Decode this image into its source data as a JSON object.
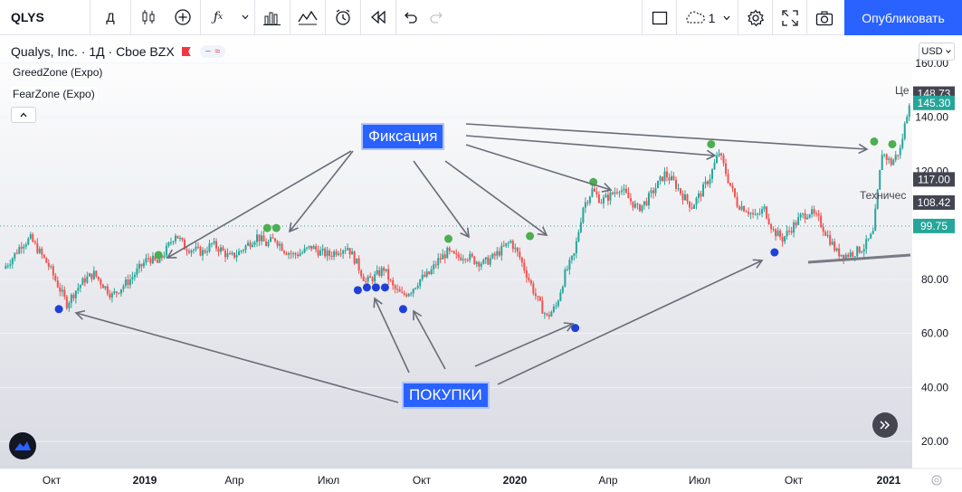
{
  "toolbar": {
    "symbol": "QLYS",
    "interval": "Д",
    "publish_label": "Опубликовать",
    "layout_count": "1",
    "icons": [
      "candles-icon",
      "add-indicator-icon",
      "fx-icon",
      "chevron-down-icon",
      "bar-chart-icon",
      "line-chart-icon",
      "alarm-icon",
      "rewind-icon",
      "undo-icon",
      "redo-icon",
      "rectangle-icon",
      "cloud-icon",
      "gear-icon",
      "fullscreen-icon",
      "camera-icon"
    ]
  },
  "legend": {
    "title": "Qualys, Inc. · 1Д · Cboe BZX",
    "pill_a": "−",
    "pill_b": "≈",
    "indicator1": "GreedZone (Expo)",
    "indicator2": "FearZone (Expo)",
    "collapse_label": "^"
  },
  "currency_label": "USD",
  "side_labels": {
    "price_partial": "Це",
    "technical_partial": "Техничес"
  },
  "annotations": {
    "fix_label": "Фиксация",
    "buy_label": "ПОКУПКИ"
  },
  "chart_data": {
    "type": "line",
    "title": "Qualys, Inc. · 1Д · Cboe BZX",
    "ylim": [
      10,
      170
    ],
    "y_ticks": [
      20,
      40,
      60,
      80,
      100,
      120,
      140,
      160
    ],
    "y_tick_labels": [
      "20.00",
      "40.00",
      "60.00",
      "80.00",
      "100.00",
      "120.00",
      "140.00",
      "160.00"
    ],
    "x_tick_labels": [
      "Окт",
      "2019",
      "Апр",
      "Июл",
      "Окт",
      "2020",
      "Апр",
      "Июл",
      "Окт",
      "2021"
    ],
    "price_tags": [
      {
        "value": 148.73,
        "label": "148.73",
        "color": "#434651"
      },
      {
        "value": 145.3,
        "label": "145.30",
        "color": "#26a69a"
      },
      {
        "value": 117.0,
        "label": "117.00",
        "color": "#434651"
      },
      {
        "value": 108.42,
        "label": "108.42",
        "color": "#434651"
      },
      {
        "value": 99.75,
        "label": "99.75",
        "color": "#26a69a"
      }
    ],
    "reference_line": 99.75,
    "series": [
      {
        "values": [
          84,
          88,
          93,
          95,
          90,
          85,
          78,
          71,
          76,
          80,
          82,
          78,
          74,
          77,
          80,
          84,
          88,
          86,
          91,
          97,
          92,
          91,
          90,
          93,
          91,
          88,
          90,
          93,
          96,
          93,
          95,
          91,
          89,
          90,
          92,
          90,
          89,
          91,
          92,
          86,
          79,
          81,
          84,
          77,
          74,
          76,
          80,
          82,
          87,
          90,
          88,
          89,
          87,
          86,
          88,
          91,
          94,
          88,
          80,
          72,
          66,
          70,
          82,
          89,
          107,
          113,
          109,
          111,
          114,
          110,
          106,
          109,
          114,
          119,
          116,
          111,
          107,
          112,
          118,
          127,
          117,
          108,
          106,
          103,
          106,
          98,
          95,
          99,
          103,
          105,
          102,
          96,
          90,
          89,
          90,
          92,
          97,
          127,
          123,
          128,
          146
        ]
      }
    ],
    "sell_signals": [
      {
        "i": 17,
        "v": 86
      },
      {
        "i": 29,
        "v": 96
      },
      {
        "i": 30,
        "v": 96
      },
      {
        "i": 49,
        "v": 92
      },
      {
        "i": 58,
        "v": 93
      },
      {
        "i": 65,
        "v": 113
      },
      {
        "i": 78,
        "v": 127
      },
      {
        "i": 96,
        "v": 128
      },
      {
        "i": 98,
        "v": 127
      }
    ],
    "buy_signals": [
      {
        "i": 6,
        "v": 71
      },
      {
        "i": 39,
        "v": 78
      },
      {
        "i": 40,
        "v": 79
      },
      {
        "i": 41,
        "v": 79
      },
      {
        "i": 42,
        "v": 79
      },
      {
        "i": 44,
        "v": 71
      },
      {
        "i": 63,
        "v": 64
      },
      {
        "i": 85,
        "v": 92
      }
    ],
    "colors": {
      "up": "#26a69a",
      "down": "#ef5350",
      "sell_signal": "#4caf50",
      "buy_signal": "#1e40d6",
      "annotation": "#2962ff"
    }
  }
}
